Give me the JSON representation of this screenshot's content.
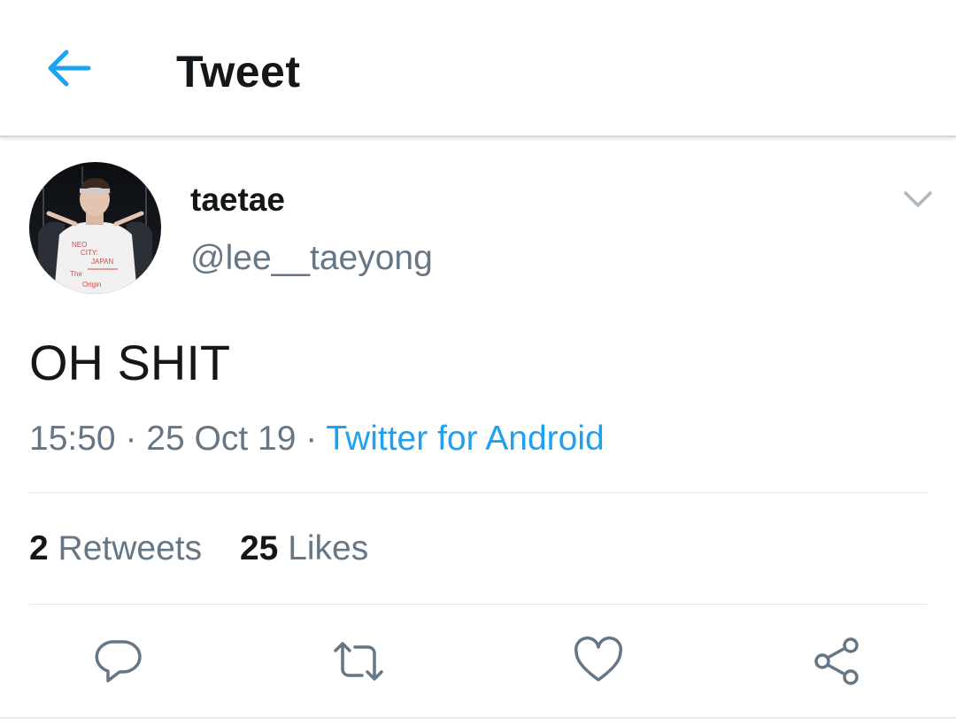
{
  "header": {
    "title": "Tweet",
    "back_icon": "arrow-left-icon",
    "accent_color": "#1da1f2"
  },
  "tweet": {
    "author": {
      "display_name": "taetae",
      "handle": "@lee__taeyong",
      "avatar_text": {
        "line1": "NEO",
        "line2": "CITY:",
        "line3": "JAPAN",
        "line4": "The",
        "line5": "Origin"
      }
    },
    "text": "OH SHIT",
    "time": "15:50",
    "date": "25 Oct 19",
    "separator": "·",
    "source": "Twitter for Android",
    "menu_icon": "chevron-down-icon"
  },
  "stats": {
    "retweets_count": "2",
    "retweets_label": "Retweets",
    "likes_count": "25",
    "likes_label": "Likes"
  },
  "actions": [
    {
      "icon": "reply-icon"
    },
    {
      "icon": "retweet-icon"
    },
    {
      "icon": "like-icon"
    },
    {
      "icon": "share-icon"
    }
  ],
  "colors": {
    "text_primary": "#14171a",
    "text_secondary": "#657786",
    "link": "#1da1f2",
    "divider": "#e1e8ed"
  }
}
